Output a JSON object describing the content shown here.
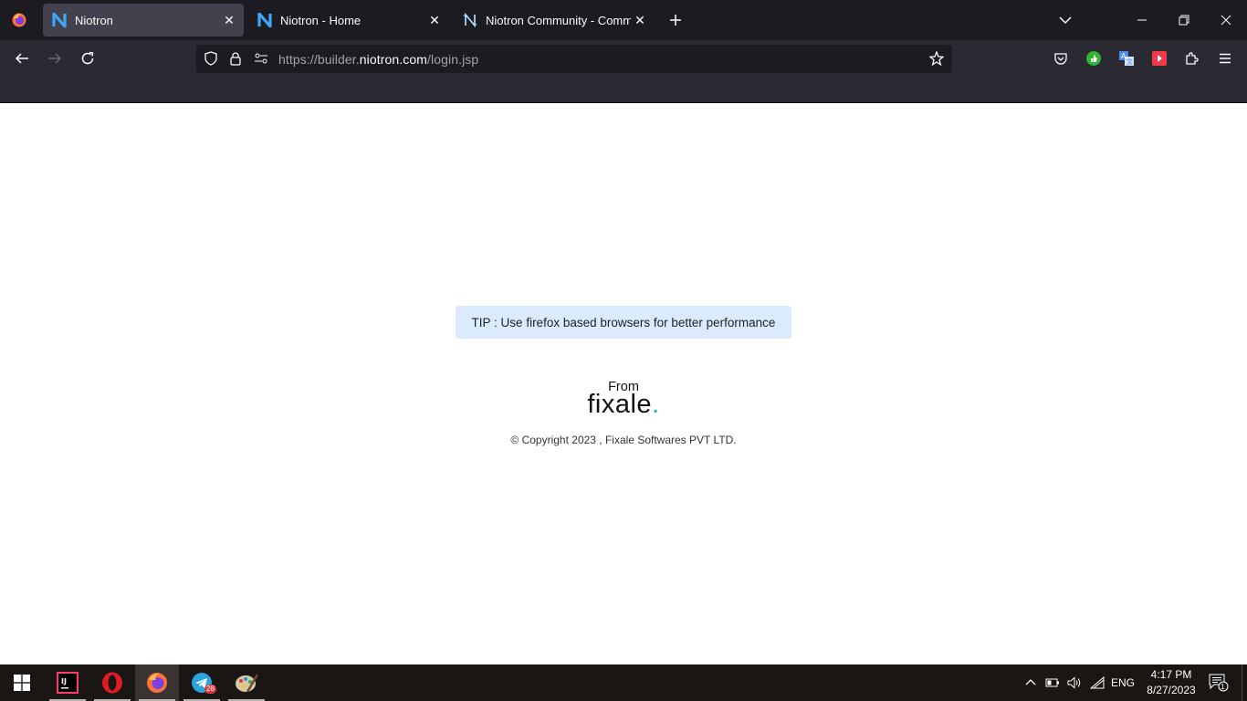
{
  "browser": {
    "tabs": [
      {
        "title": "Niotron",
        "active": true
      },
      {
        "title": "Niotron - Home",
        "active": false
      },
      {
        "title": "Niotron Community - Commun",
        "active": false
      }
    ],
    "url": {
      "prefix": "https://builder.",
      "domain": "niotron.com",
      "path": "/login.jsp"
    },
    "icons": {
      "firefox_menu": "firefox-icon",
      "back": "back-arrow-icon",
      "forward": "forward-arrow-icon",
      "reload": "reload-icon",
      "shield": "shield-icon",
      "lock": "lock-icon",
      "permissions": "permissions-icon",
      "bookmark": "star-icon",
      "pocket": "pocket-icon",
      "extensions": [
        "thumbs-up-extension-icon",
        "translate-extension-icon",
        "youtube-extension-icon",
        "puzzle-extensions-icon"
      ],
      "menu": "hamburger-menu-icon"
    },
    "accent_colors": {
      "tab_bar": "#1c1b22",
      "nav_bar": "#2b2a33",
      "active_tab": "#42414d"
    }
  },
  "page": {
    "tip": "TIP : Use firefox based browsers for better performance",
    "from_label": "From",
    "brand": "fixale",
    "brand_dot": ".",
    "copyright": "© Copyright 2023 , Fixale Softwares PVT LTD.",
    "tip_bg": "#dbeafc",
    "brand_dot_color": "#1bb5a5"
  },
  "taskbar": {
    "apps": [
      "windows-start-icon",
      "intellij-icon",
      "opera-icon",
      "firefox-icon",
      "telegram-icon",
      "paint-icon"
    ],
    "telegram_badge": "28",
    "language": "ENG",
    "time": "4:17 PM",
    "date": "8/27/2023",
    "notification_count": "1"
  }
}
